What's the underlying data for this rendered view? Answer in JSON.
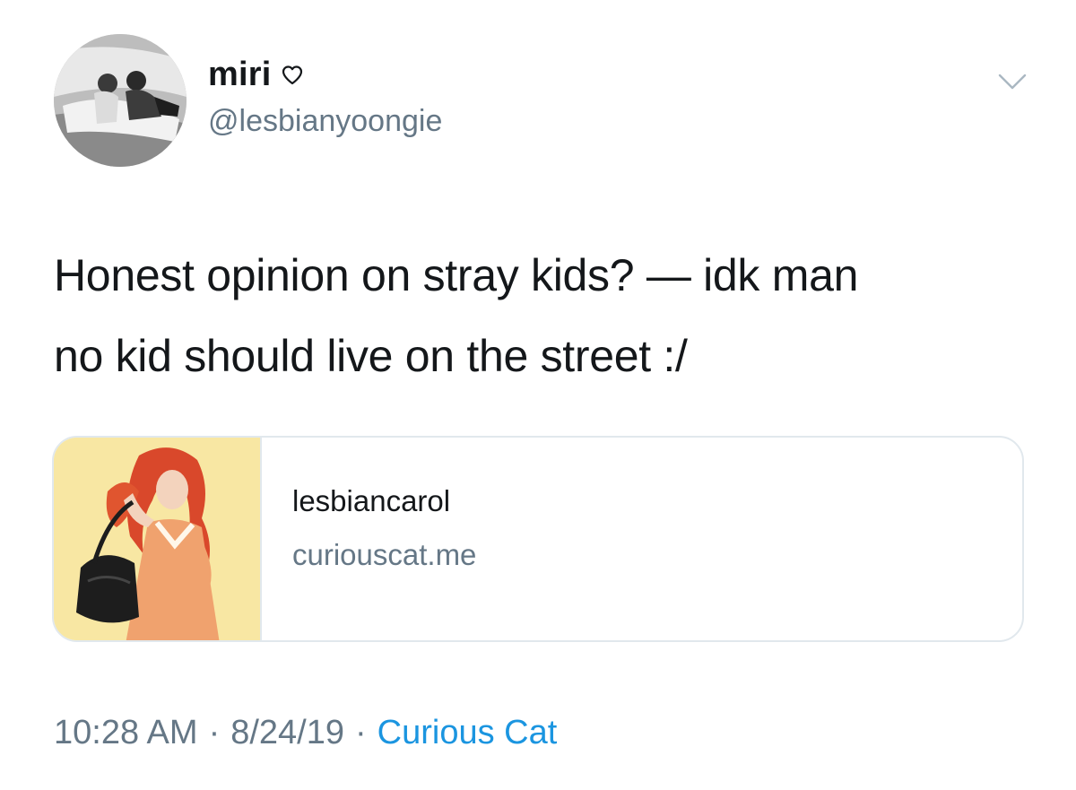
{
  "user": {
    "display_name": "miri",
    "name_icon": "heart-outline-icon",
    "handle": "@lesbianyoongie",
    "avatar": "profile-photo"
  },
  "menu_icon": "chevron-down-icon",
  "tweet": {
    "line1": "Honest opinion on stray kids? — idk man",
    "line2": "no kid should live on the street :/"
  },
  "card": {
    "thumbnail": "illustration-red-haired-woman",
    "title": "lesbiancarol",
    "domain": "curiouscat.me"
  },
  "meta": {
    "time": "10:28 AM",
    "separator": "·",
    "date": "8/24/19",
    "source": "Curious Cat"
  },
  "colors": {
    "text": "#14171a",
    "secondary": "#657786",
    "link": "#1b95e0",
    "border": "#e1e8ed",
    "thumb_bg": "#f8e7a3"
  }
}
